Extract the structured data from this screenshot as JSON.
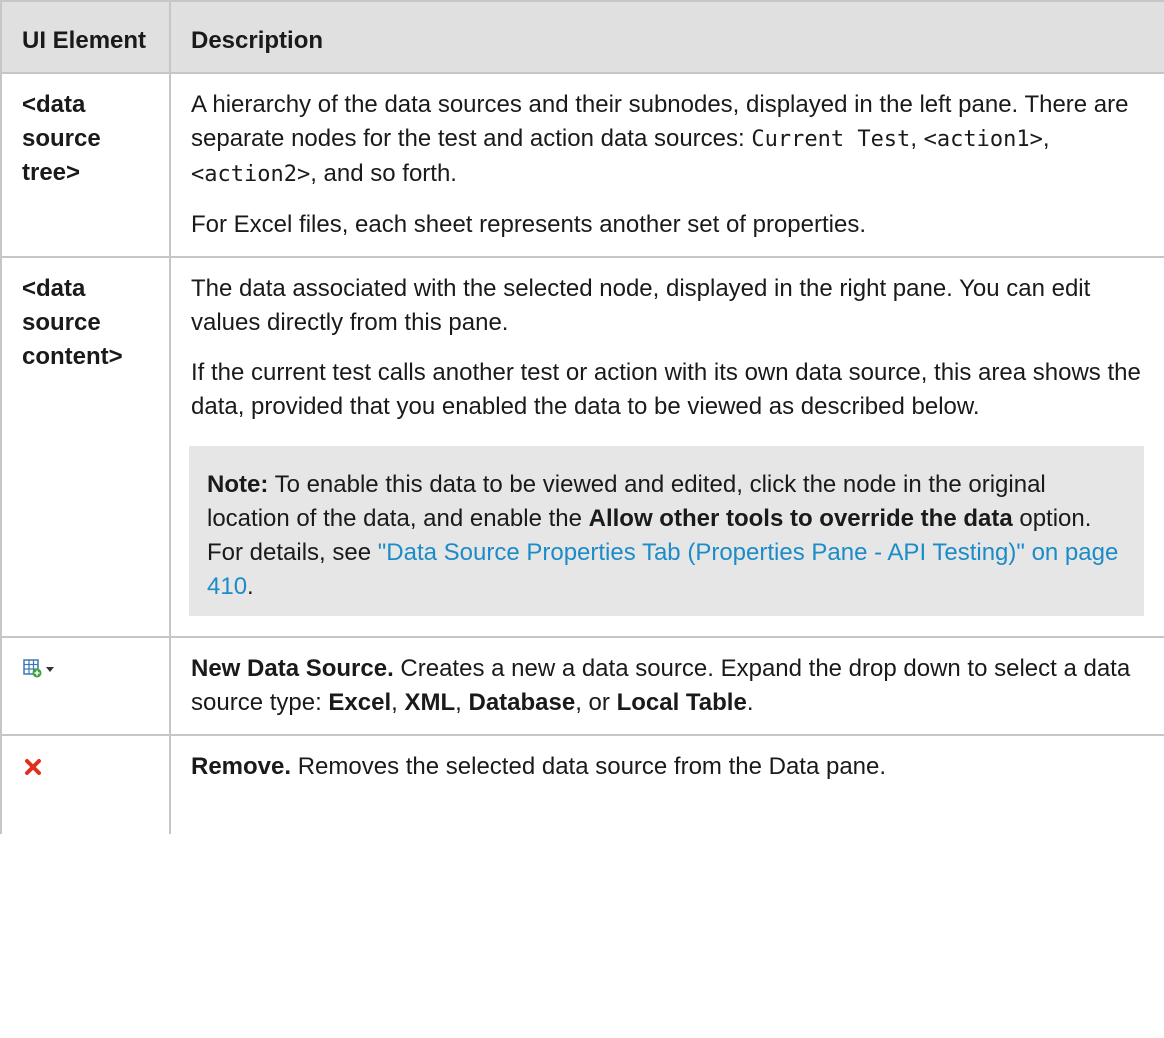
{
  "header": {
    "col1": "UI Element",
    "col2": "Description"
  },
  "rows": {
    "tree": {
      "element": "<data source tree>",
      "p1_text": "A hierarchy of the data sources and their subnodes, displayed in the left pane. There are separate nodes for the test and action data sources: ",
      "code1": "Current Test",
      "sep1": ", ",
      "code2": "<action1>",
      "sep2": ", ",
      "code3": "<action2>",
      "p1_end": ", and so forth.",
      "p2": "For Excel files, each sheet represents another set of properties."
    },
    "content": {
      "element": "<data source content>",
      "p1": "The data associated with the selected node, displayed in the right pane. You can edit values directly from this pane.",
      "p2": "If the current test calls another test or action with its own data source, this area shows the data, provided that you enabled the data to be viewed as described below.",
      "note": {
        "label": "Note:",
        "text1": " To enable this data to be viewed and edited, click the node in the original location of the data, and enable the ",
        "bold": "Allow other tools to override the data",
        "text2": " option. For details, see ",
        "link": "\"Data Source Properties Tab (Properties Pane - API Testing)\" on page 410",
        "end": "."
      }
    },
    "new_source": {
      "icon": "new-data-source-icon",
      "title": "New Data Source.",
      "text1": " Creates a new a data source. Expand the drop down to select a data source type: ",
      "t1": "Excel",
      "s1": ", ",
      "t2": "XML",
      "s2": ", ",
      "t3": "Database",
      "s3": ", or ",
      "t4": "Local Table",
      "end": "."
    },
    "remove": {
      "icon": "remove-icon",
      "title": "Remove.",
      "text": " Removes the selected data source from the Data pane."
    }
  },
  "colors": {
    "header_bg": "#e0e0e0",
    "note_bg": "#e6e6e6",
    "link": "#1c8cc8",
    "border": "#c6c6c6",
    "remove_icon": "#e0301e"
  }
}
